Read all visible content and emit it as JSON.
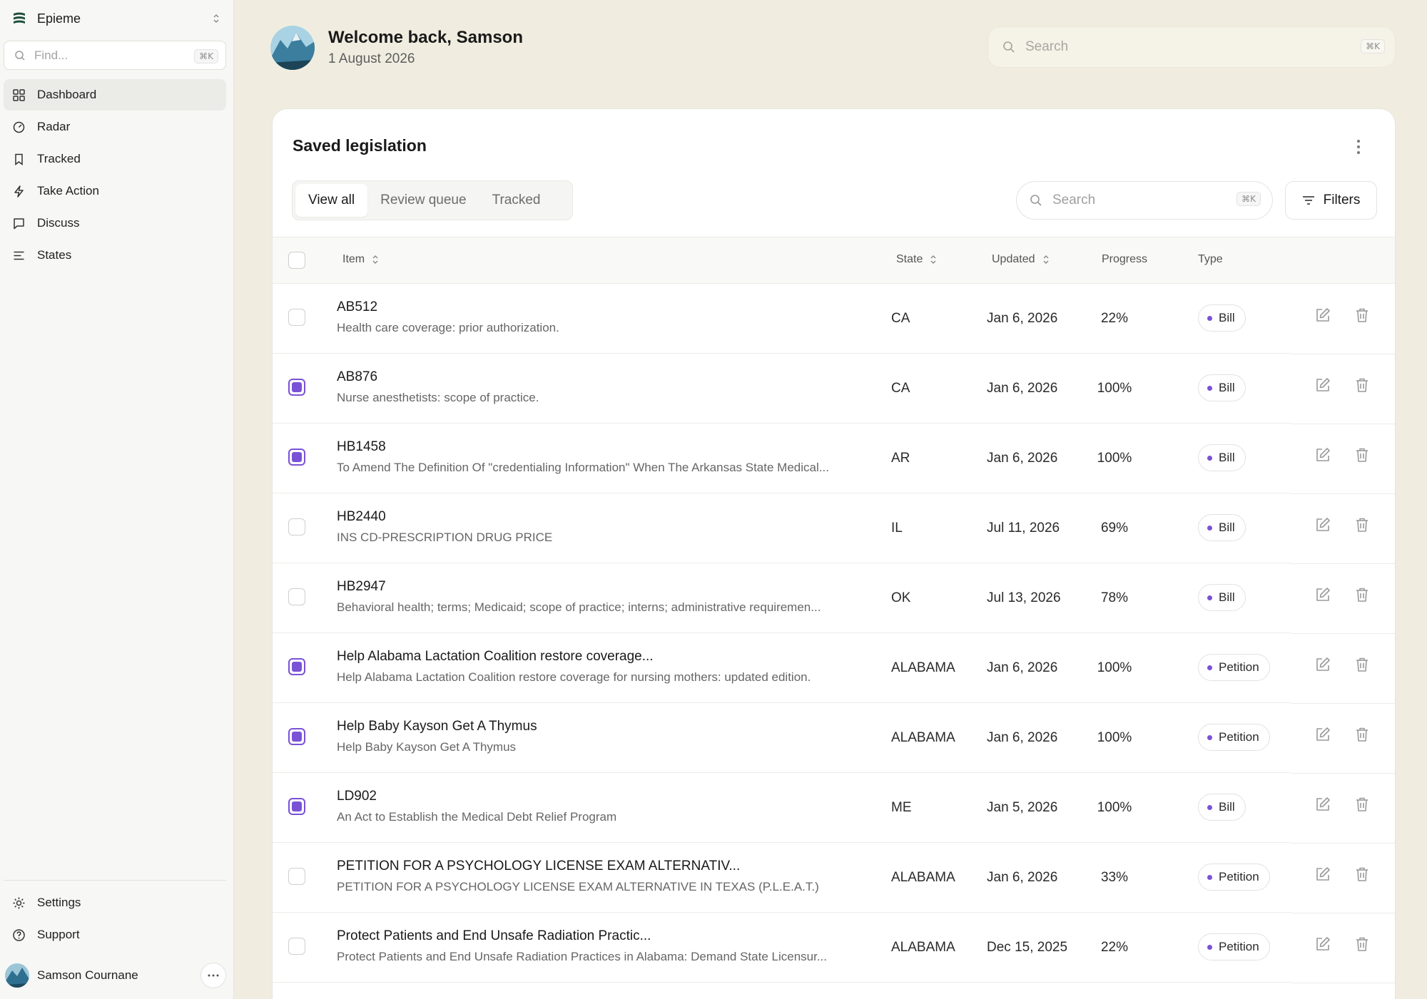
{
  "sidebar": {
    "brand": "Epieme",
    "find_placeholder": "Find...",
    "find_shortcut": "⌘K",
    "items": [
      {
        "label": "Dashboard",
        "icon": "grid-icon",
        "active": true
      },
      {
        "label": "Radar",
        "icon": "radar-icon"
      },
      {
        "label": "Tracked",
        "icon": "bookmark-icon"
      },
      {
        "label": "Take Action",
        "icon": "bolt-icon"
      },
      {
        "label": "Discuss",
        "icon": "chat-icon"
      },
      {
        "label": "States",
        "icon": "list-icon"
      }
    ],
    "bottom_items": [
      {
        "label": "Settings",
        "icon": "gear-icon"
      },
      {
        "label": "Support",
        "icon": "help-icon"
      }
    ],
    "user_name": "Samson Cournane"
  },
  "header": {
    "welcome": "Welcome back, Samson",
    "date": "1 August 2026",
    "search_placeholder": "Search",
    "search_shortcut": "⌘K"
  },
  "card": {
    "title": "Saved legislation",
    "tabs": [
      "View all",
      "Review queue",
      "Tracked"
    ],
    "search_placeholder": "Search",
    "search_shortcut": "⌘K",
    "filters_label": "Filters",
    "columns": {
      "item": "Item",
      "state": "State",
      "updated": "Updated",
      "progress": "Progress",
      "type": "Type"
    },
    "rows": [
      {
        "checked": false,
        "title": "AB512",
        "desc": "Health care coverage: prior authorization.",
        "state": "CA",
        "updated": "Jan 6, 2026",
        "progress": "22%",
        "type": "Bill"
      },
      {
        "checked": true,
        "title": "AB876",
        "desc": "Nurse anesthetists: scope of practice.",
        "state": "CA",
        "updated": "Jan 6, 2026",
        "progress": "100%",
        "type": "Bill"
      },
      {
        "checked": true,
        "title": "HB1458",
        "desc": "To Amend The Definition Of \"credentialing Information\" When The Arkansas State Medical...",
        "state": "AR",
        "updated": "Jan 6, 2026",
        "progress": "100%",
        "type": "Bill"
      },
      {
        "checked": false,
        "title": "HB2440",
        "desc": "INS CD-PRESCRIPTION DRUG PRICE",
        "state": "IL",
        "updated": "Jul 11, 2026",
        "progress": "69%",
        "type": "Bill"
      },
      {
        "checked": false,
        "title": "HB2947",
        "desc": "Behavioral health; terms; Medicaid; scope of practice; interns; administrative requiremen...",
        "state": "OK",
        "updated": "Jul 13, 2026",
        "progress": "78%",
        "type": "Bill"
      },
      {
        "checked": true,
        "title": "Help Alabama Lactation Coalition restore coverage...",
        "desc": "Help Alabama Lactation Coalition restore coverage for nursing mothers: updated edition.",
        "state": "ALABAMA",
        "updated": "Jan 6, 2026",
        "progress": "100%",
        "type": "Petition"
      },
      {
        "checked": true,
        "title": "Help Baby Kayson Get A Thymus",
        "desc": "Help Baby Kayson Get A Thymus",
        "state": "ALABAMA",
        "updated": "Jan 6, 2026",
        "progress": "100%",
        "type": "Petition"
      },
      {
        "checked": true,
        "title": "LD902",
        "desc": "An Act to Establish the Medical Debt Relief Program",
        "state": "ME",
        "updated": "Jan 5, 2026",
        "progress": "100%",
        "type": "Bill"
      },
      {
        "checked": false,
        "title": "PETITION FOR A PSYCHOLOGY LICENSE EXAM ALTERNATIV...",
        "desc": "PETITION FOR A PSYCHOLOGY LICENSE EXAM ALTERNATIVE IN TEXAS (P.L.E.A.T.)",
        "state": "ALABAMA",
        "updated": "Jan 6, 2026",
        "progress": "33%",
        "type": "Petition"
      },
      {
        "checked": false,
        "title": "Protect Patients and End Unsafe Radiation Practic...",
        "desc": "Protect Patients and End Unsafe Radiation Practices in Alabama: Demand State Licensur...",
        "state": "ALABAMA",
        "updated": "Dec 15, 2025",
        "progress": "22%",
        "type": "Petition"
      }
    ]
  },
  "colors": {
    "accent": "#7a52d6",
    "background": "#f0ede0",
    "sidebar": "#f7f7f5"
  }
}
